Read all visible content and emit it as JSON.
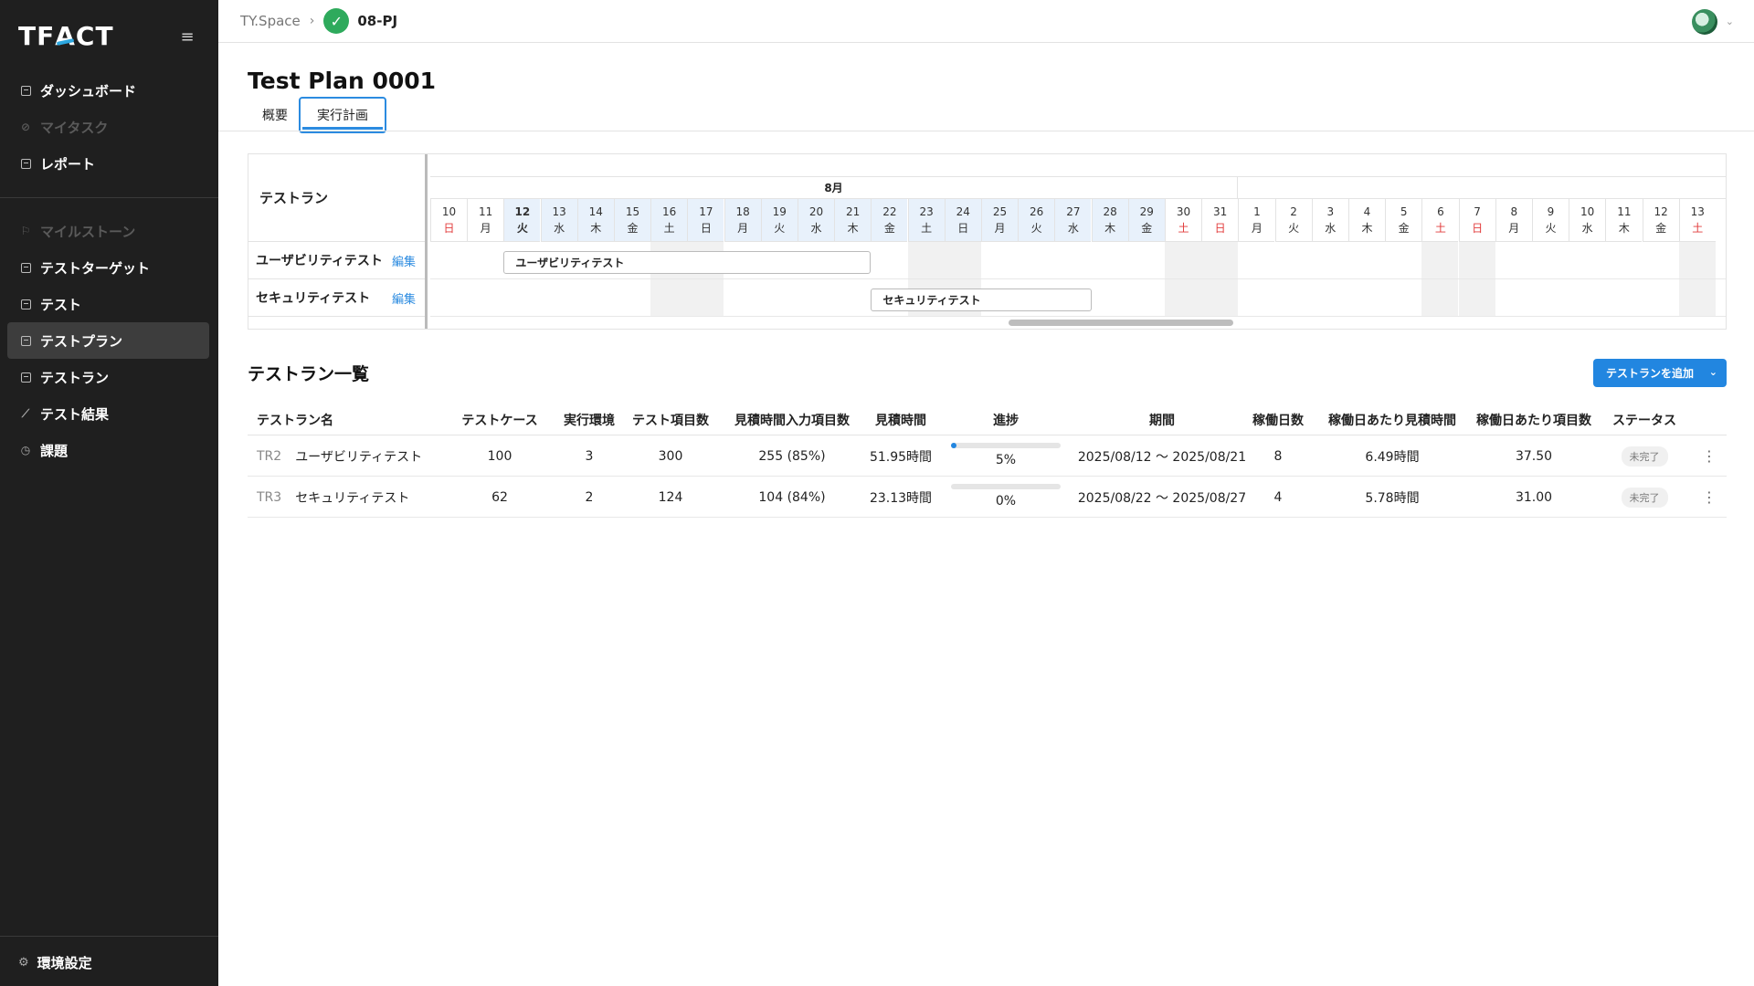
{
  "app": {
    "logo": "TFACT"
  },
  "sidebar": {
    "items": [
      {
        "label": "ダッシュボード",
        "icon": "dashboard-icon",
        "disabled": false,
        "active": false
      },
      {
        "label": "マイタスク",
        "icon": "task-icon",
        "disabled": true,
        "active": false
      },
      {
        "label": "レポート",
        "icon": "report-icon",
        "disabled": false,
        "active": false
      },
      {
        "label": "マイルストーン",
        "icon": "flag-icon",
        "disabled": true,
        "active": false
      },
      {
        "label": "テストターゲット",
        "icon": "target-icon",
        "disabled": false,
        "active": false
      },
      {
        "label": "テスト",
        "icon": "test-icon",
        "disabled": false,
        "active": false
      },
      {
        "label": "テストプラン",
        "icon": "plan-icon",
        "disabled": false,
        "active": true
      },
      {
        "label": "テストラン",
        "icon": "run-icon",
        "disabled": false,
        "active": false
      },
      {
        "label": "テスト結果",
        "icon": "result-icon",
        "disabled": false,
        "active": false
      },
      {
        "label": "課題",
        "icon": "issue-icon",
        "disabled": false,
        "active": false
      }
    ],
    "settings_label": "環境設定"
  },
  "breadcrumb": {
    "space": "TY.Space",
    "project": "08-PJ"
  },
  "page": {
    "title": "Test Plan 0001"
  },
  "tabs": [
    {
      "label": "概要"
    },
    {
      "label": "実行計画"
    }
  ],
  "gantt": {
    "header_label": "テストラン",
    "month_label": "8月",
    "days": [
      {
        "d": "10",
        "w": "日",
        "red": true,
        "hl": false,
        "today": false
      },
      {
        "d": "11",
        "w": "月",
        "red": false,
        "hl": false,
        "today": false
      },
      {
        "d": "12",
        "w": "火",
        "red": false,
        "hl": true,
        "today": true
      },
      {
        "d": "13",
        "w": "水",
        "red": false,
        "hl": true,
        "today": false
      },
      {
        "d": "14",
        "w": "木",
        "red": false,
        "hl": true,
        "today": false
      },
      {
        "d": "15",
        "w": "金",
        "red": false,
        "hl": true,
        "today": false
      },
      {
        "d": "16",
        "w": "土",
        "red": false,
        "hl": true,
        "today": false
      },
      {
        "d": "17",
        "w": "日",
        "red": false,
        "hl": true,
        "today": false
      },
      {
        "d": "18",
        "w": "月",
        "red": false,
        "hl": true,
        "today": false
      },
      {
        "d": "19",
        "w": "火",
        "red": false,
        "hl": true,
        "today": false
      },
      {
        "d": "20",
        "w": "水",
        "red": false,
        "hl": true,
        "today": false
      },
      {
        "d": "21",
        "w": "木",
        "red": false,
        "hl": true,
        "today": false
      },
      {
        "d": "22",
        "w": "金",
        "red": false,
        "hl": true,
        "today": false
      },
      {
        "d": "23",
        "w": "土",
        "red": false,
        "hl": true,
        "today": false
      },
      {
        "d": "24",
        "w": "日",
        "red": false,
        "hl": true,
        "today": false
      },
      {
        "d": "25",
        "w": "月",
        "red": false,
        "hl": true,
        "today": false
      },
      {
        "d": "26",
        "w": "火",
        "red": false,
        "hl": true,
        "today": false
      },
      {
        "d": "27",
        "w": "水",
        "red": false,
        "hl": true,
        "today": false
      },
      {
        "d": "28",
        "w": "木",
        "red": false,
        "hl": true,
        "today": false
      },
      {
        "d": "29",
        "w": "金",
        "red": false,
        "hl": true,
        "today": false
      },
      {
        "d": "30",
        "w": "土",
        "red": true,
        "hl": false,
        "today": false
      },
      {
        "d": "31",
        "w": "日",
        "red": true,
        "hl": false,
        "today": false
      },
      {
        "d": "1",
        "w": "月",
        "red": false,
        "hl": false,
        "today": false
      },
      {
        "d": "2",
        "w": "火",
        "red": false,
        "hl": false,
        "today": false
      },
      {
        "d": "3",
        "w": "水",
        "red": false,
        "hl": false,
        "today": false
      },
      {
        "d": "4",
        "w": "木",
        "red": false,
        "hl": false,
        "today": false
      },
      {
        "d": "5",
        "w": "金",
        "red": false,
        "hl": false,
        "today": false
      },
      {
        "d": "6",
        "w": "土",
        "red": true,
        "hl": false,
        "today": false
      },
      {
        "d": "7",
        "w": "日",
        "red": true,
        "hl": false,
        "today": false
      },
      {
        "d": "8",
        "w": "月",
        "red": false,
        "hl": false,
        "today": false
      },
      {
        "d": "9",
        "w": "火",
        "red": false,
        "hl": false,
        "today": false
      },
      {
        "d": "10",
        "w": "水",
        "red": false,
        "hl": false,
        "today": false
      },
      {
        "d": "11",
        "w": "木",
        "red": false,
        "hl": false,
        "today": false
      },
      {
        "d": "12",
        "w": "金",
        "red": false,
        "hl": false,
        "today": false
      },
      {
        "d": "13",
        "w": "土",
        "red": true,
        "hl": false,
        "today": false
      }
    ],
    "rows": [
      {
        "label": "ユーザビリティテスト",
        "edit": "編集",
        "bar_label": "ユーザビリティテスト",
        "start_day": "12",
        "end_day": "21"
      },
      {
        "label": "セキュリティテスト",
        "edit": "編集",
        "bar_label": "セキュリティテスト",
        "start_day": "22",
        "end_day": "27"
      }
    ]
  },
  "list": {
    "title": "テストラン一覧",
    "add_button": "テストランを追加",
    "headers": [
      "テストラン名",
      "テストケース",
      "実行環境",
      "テスト項目数",
      "見積時間入力項目数",
      "見積時間",
      "進捗",
      "期間",
      "稼働日数",
      "稼働日あたり見積時間",
      "稼働日あたり項目数",
      "ステータス"
    ],
    "rows": [
      {
        "id": "TR2",
        "name": "ユーザビリティテスト",
        "cases": "100",
        "envs": "3",
        "items": "300",
        "est_input": "255 (85%)",
        "est_time": "51.95時間",
        "progress": 0.05,
        "progress_text": "5%",
        "period": "2025/08/12 〜 2025/08/21",
        "work_days": "8",
        "per_day_time": "6.49時間",
        "per_day_items": "37.50",
        "status": "未完了"
      },
      {
        "id": "TR3",
        "name": "セキュリティテスト",
        "cases": "62",
        "envs": "2",
        "items": "124",
        "est_input": "104 (84%)",
        "est_time": "23.13時間",
        "progress": 0.0,
        "progress_text": "0%",
        "period": "2025/08/22 〜 2025/08/27",
        "work_days": "4",
        "per_day_time": "5.78時間",
        "per_day_items": "31.00",
        "status": "未完了"
      }
    ]
  },
  "colors": {
    "accent": "#2286e0",
    "sidebar_bg": "#1f1f1f",
    "project_icon": "#2eaa5c",
    "weekend_red": "#e23b3b"
  }
}
